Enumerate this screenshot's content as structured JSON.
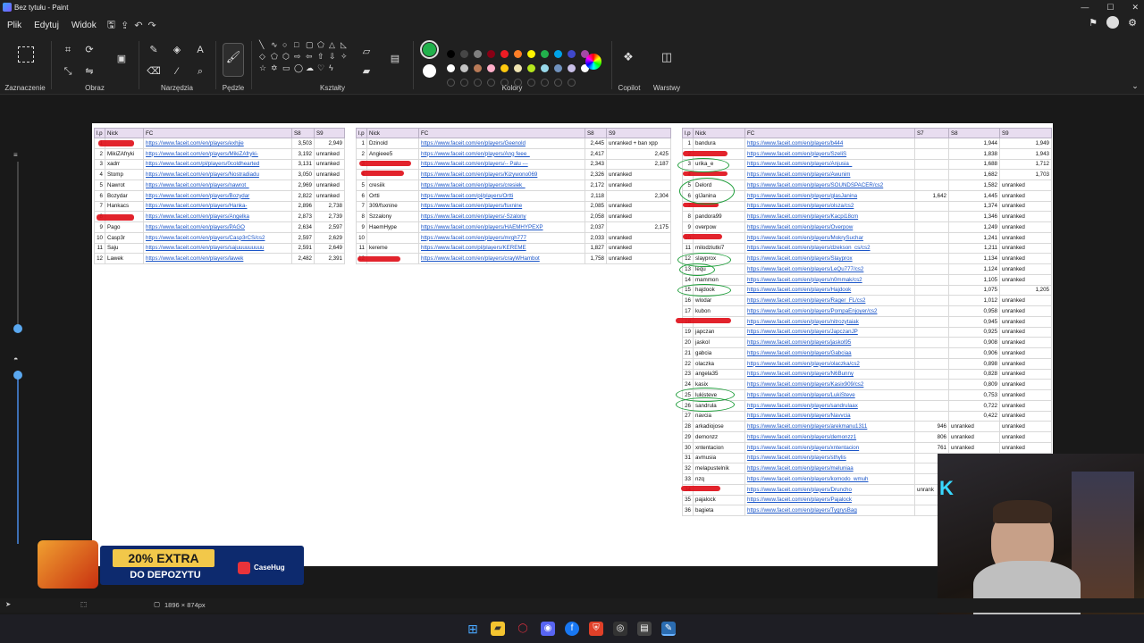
{
  "window": {
    "title": "Bez tytułu - Paint",
    "min": "—",
    "max": "☐",
    "close": "✕"
  },
  "menu": [
    "Plik",
    "Edytuj",
    "Widok"
  ],
  "ribbon": {
    "groups": [
      "Zaznaczenie",
      "Obraz",
      "Narzędzia",
      "Pędzle",
      "Kształty",
      "Kolory",
      "Copilot",
      "Warstwy"
    ],
    "colors_row1": [
      "#000000",
      "#464646",
      "#7f7f7f",
      "#880015",
      "#ed1c24",
      "#ff7f27",
      "#fff200",
      "#22b14c",
      "#00a2e8",
      "#3f48cc",
      "#a349a4"
    ],
    "colors_row2": [
      "#ffffff",
      "#c3c3c3",
      "#b97a57",
      "#ffaec9",
      "#ffc90e",
      "#efe4b0",
      "#b5e61d",
      "#99d9ea",
      "#7092be",
      "#c8bfe7",
      "#ffffff"
    ],
    "primary_color": "#22b14c",
    "secondary_color": "#ffffff"
  },
  "table1": {
    "headers": [
      "l.p",
      "Nick",
      "FC",
      "S8",
      "S9"
    ],
    "rows": [
      [
        "1",
        "",
        "https://www.faceit.com/en/players/exhjie",
        "3,503",
        "2,949"
      ],
      [
        "2",
        "MikiZAfryki",
        "https://www.faceit.com/en/players/MikiZAfryki-",
        "3,192",
        "unranked"
      ],
      [
        "3",
        "xadrr",
        "https://www.faceit.com/pl/players/0coldhearted",
        "3,131",
        "unranked"
      ],
      [
        "4",
        "Stomp",
        "https://www.faceit.com/en/players/Nostradiadu",
        "3,050",
        "unranked"
      ],
      [
        "5",
        "Nawrot",
        "https://www.faceit.com/en/players/nawrot_",
        "2,969",
        "unranked"
      ],
      [
        "6",
        "Bozydar",
        "https://www.faceit.com/en/players/Bozydar",
        "2,822",
        "unranked"
      ],
      [
        "7",
        "Hankacs",
        "https://www.faceit.com/en/players/Hanka-",
        "2,896",
        "2,738"
      ],
      [
        "8",
        "",
        "https://www.faceit.com/en/players/Angelka",
        "2,873",
        "2,739"
      ],
      [
        "9",
        "Pago",
        "https://www.faceit.com/en/players/PAGO",
        "2,634",
        "2,597"
      ],
      [
        "10",
        "Casp3r",
        "https://www.faceit.com/en/players/Casp3rCS/cs2",
        "2,597",
        "2,629"
      ],
      [
        "11",
        "Saju",
        "https://www.faceit.com/en/players/sajuuuuuuuuu",
        "2,591",
        "2,649"
      ],
      [
        "12",
        "Lawek",
        "https://www.faceit.com/en/players/lawek",
        "2,482",
        "2,391"
      ]
    ]
  },
  "table2": {
    "headers": [
      "l.p",
      "Nick",
      "FC",
      "S8",
      "S9"
    ],
    "rows": [
      [
        "1",
        "Dzinold",
        "https://www.faceit.com/en/players/Geenold",
        "2,445",
        "unranked + ban xpp"
      ],
      [
        "2",
        "Angieee5",
        "https://www.faceit.com/en/players/Ang feee_",
        "2,417",
        "2,425"
      ],
      [
        "3",
        "",
        "https://www.faceit.com/en/players/-- Palu ---",
        "2,343",
        "2,187"
      ],
      [
        "4",
        "",
        "https://www.faceit.com/en/players/Kizywono069",
        "2,326",
        "unranked"
      ],
      [
        "5",
        "cresiik",
        "https://www.faceit.com/en/players/cresiek_",
        "2,172",
        "unranked"
      ],
      [
        "6",
        "Ortti",
        "https://www.faceit.com/pl/players/Ortti",
        "2,118",
        "2,304"
      ],
      [
        "7",
        "309/fsxnine",
        "https://www.faceit.com/en/players/fsxnine",
        "2,085",
        "unranked"
      ],
      [
        "8",
        "Szzalony",
        "https://www.faceit.com/en/players/-Szalony",
        "2,058",
        "unranked"
      ],
      [
        "9",
        "HaemHype",
        "https://www.faceit.com/en/players/HAEMHYPEXP",
        "2,037",
        "2,175"
      ],
      [
        "10",
        "",
        "https://www.faceit.com/en/players/mrgh777",
        "2,033",
        "unranked"
      ],
      [
        "11",
        "kereme",
        "https://www.faceit.com/pl/players/KEREME",
        "1,827",
        "unranked"
      ],
      [
        "12",
        "",
        "https://www.faceit.com/en/players/crayWHambot",
        "1,758",
        "unranked"
      ]
    ]
  },
  "table3": {
    "headers": [
      "l.p",
      "Nick",
      "FC",
      "S7",
      "S8",
      "S9"
    ],
    "rows": [
      [
        "1",
        "bandura",
        "https://www.faceit.com/en/players/b444",
        "",
        "1,944",
        "1,949"
      ],
      [
        "2",
        "",
        "https://www.faceit.com/en/players/SzeliS",
        "",
        "1,838",
        "1,943"
      ],
      [
        "3",
        "urika_e",
        "https://www.faceit.com/en/players/Anjusia_",
        "",
        "1,688",
        "1,712"
      ],
      [
        "4",
        "",
        "https://www.faceit.com/en/players/Awunim",
        "",
        "1,682",
        "1,703"
      ],
      [
        "5",
        "Delord",
        "https://www.faceit.com/en/players/SOUNDSPACER/cs2",
        "",
        "1,582",
        "unranked"
      ],
      [
        "6",
        "glJanina",
        "https://www.faceit.com/en/players/glasJanina",
        "1,642",
        "1,445",
        "unranked"
      ],
      [
        "7",
        "",
        "https://www.faceit.com/en/players/olsza/cs2",
        "",
        "1,374",
        "unranked"
      ],
      [
        "8",
        "pandora99",
        "https://www.faceit.com/en/players/Kacpi18cm",
        "",
        "1,346",
        "unranked"
      ],
      [
        "9",
        "overpow",
        "https://www.faceit.com/en/players/Overpow",
        "",
        "1,249",
        "unranked"
      ],
      [
        "10",
        "",
        "https://www.faceit.com/en/players/MokrySuchar",
        "",
        "1,241",
        "unranked"
      ],
      [
        "11",
        "milodziutki7",
        "https://www.faceit.com/en/players/dzekson_cs/cs2",
        "",
        "1,211",
        "unranked"
      ],
      [
        "12",
        "slayprox",
        "https://www.faceit.com/en/players/Slayprox",
        "",
        "1,134",
        "unranked"
      ],
      [
        "13",
        "lequ",
        "https://www.faceit.com/en/players/LeQu777/cs2",
        "",
        "1,124",
        "unranked"
      ],
      [
        "14",
        "mammon",
        "https://www.faceit.com/en/players/n0mmak/cs2",
        "",
        "1,105",
        "unranked"
      ],
      [
        "15",
        "hajdook",
        "https://www.faceit.com/en/players/Hajdook",
        "",
        "1,075",
        "1,205"
      ],
      [
        "16",
        "wlodar",
        "https://www.faceit.com/en/players/Rager_FL/cs2",
        "",
        "1,012",
        "unranked"
      ],
      [
        "17",
        "kubon",
        "https://www.faceit.com/en/players/PompaEnjoyer/cs2",
        "",
        "0,958",
        "unranked"
      ],
      [
        "18",
        "",
        "https://www.faceit.com/en/players/nitrozytaiak",
        "",
        "0,945",
        "unranked"
      ],
      [
        "19",
        "japczan",
        "https://www.faceit.com/en/players/JapczanJP",
        "",
        "0,925",
        "unranked"
      ],
      [
        "20",
        "jaskol",
        "https://www.faceit.com/en/players/jaskol95",
        "",
        "0,908",
        "unranked"
      ],
      [
        "21",
        "gabcia",
        "https://www.faceit.com/en/players/Gabciaa",
        "",
        "0,906",
        "unranked"
      ],
      [
        "22",
        "olaczka",
        "https://www.faceit.com/en/players/olaczka/cs2",
        "",
        "0,898",
        "unranked"
      ],
      [
        "23",
        "angela35",
        "https://www.faceit.com/en/players/N6Bunny",
        "",
        "0,828",
        "unranked"
      ],
      [
        "24",
        "kasix",
        "https://www.faceit.com/en/players/Kasix909/cs2",
        "",
        "0,809",
        "unranked"
      ],
      [
        "25",
        "lukisteve",
        "https://www.faceit.com/en/players/LukiSteve",
        "",
        "0,753",
        "unranked"
      ],
      [
        "26",
        "sandrula",
        "https://www.faceit.com/en/players/sandrulaax",
        "",
        "0,722",
        "unranked"
      ],
      [
        "27",
        "navcia",
        "https://www.faceit.com/en/players/Navvcia",
        "",
        "0,422",
        "unranked"
      ],
      [
        "28",
        "arkadiojose",
        "https://www.faceit.com/en/players/arekmanu1311",
        "946",
        "unranked",
        "unranked"
      ],
      [
        "29",
        "demonzz",
        "https://www.faceit.com/en/players/demonzz1",
        "806",
        "unranked",
        "unranked"
      ],
      [
        "30",
        "xntentacion",
        "https://www.faceit.com/en/players/xntentacion",
        "761",
        "unranked",
        "unranked"
      ],
      [
        "31",
        "avmusia",
        "https://www.faceit.com/en/players/sthylis",
        "",
        "",
        ""
      ],
      [
        "32",
        "melapustelnik",
        "https://www.faceit.com/en/players/meluniaa",
        "",
        "",
        ""
      ],
      [
        "33",
        "nzq",
        "https://www.faceit.com/en/players/komodo_wmuh",
        "",
        "",
        ""
      ],
      [
        "34",
        "",
        "https://www.faceit.com/en/players/Druncho",
        "unrank",
        "",
        ""
      ],
      [
        "35",
        "pajalock",
        "https://www.faceit.com/en/players/Pajalock",
        "1,",
        "",
        ""
      ],
      [
        "36",
        "bagieta",
        "https://www.faceit.com/en/players/TygrysBag",
        "",
        "",
        ""
      ]
    ]
  },
  "banner": {
    "line1": "20% EXTRA",
    "line2": "DO DEPOZYTU",
    "brand": "CaseHug"
  },
  "status": {
    "canvas_size": "1896 × 874px"
  },
  "colors": {
    "accent": "#22b14c",
    "link": "#1a55c8",
    "header_bg": "#e8ddf0"
  }
}
